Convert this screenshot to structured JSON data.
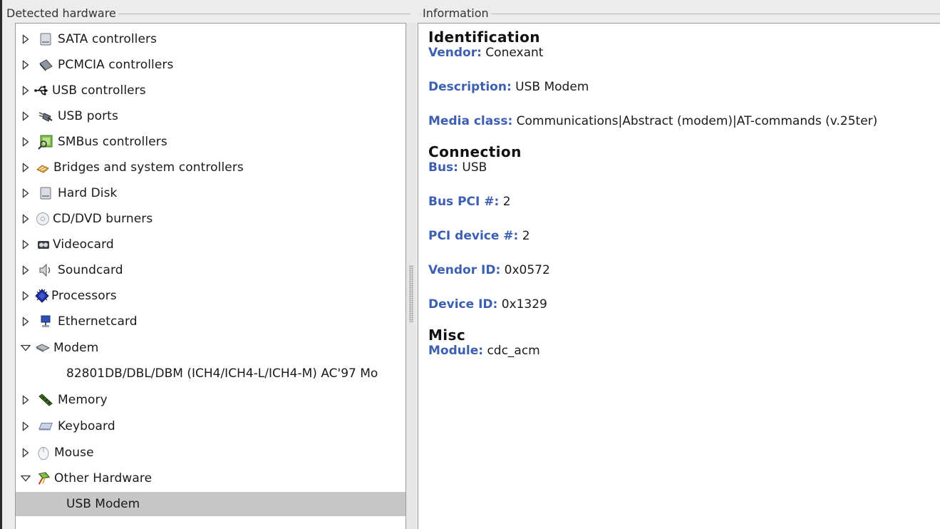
{
  "left_panel": {
    "title": "Detected hardware",
    "items": [
      {
        "label": "SATA controllers",
        "icon": "sata-controller-icon",
        "expanded": false
      },
      {
        "label": "PCMCIA controllers",
        "icon": "pcmcia-card-icon",
        "expanded": false
      },
      {
        "label": "USB controllers",
        "icon": "usb-symbol-icon",
        "expanded": false
      },
      {
        "label": "USB ports",
        "icon": "usb-plug-icon",
        "expanded": false
      },
      {
        "label": "SMBus controllers",
        "icon": "smbus-icon",
        "expanded": false
      },
      {
        "label": "Bridges and system controllers",
        "icon": "bridge-icon",
        "expanded": false
      },
      {
        "label": "Hard Disk",
        "icon": "hard-disk-icon",
        "expanded": false
      },
      {
        "label": "CD/DVD burners",
        "icon": "cd-dvd-icon",
        "expanded": false
      },
      {
        "label": "Videocard",
        "icon": "videocard-icon",
        "expanded": false
      },
      {
        "label": "Soundcard",
        "icon": "speaker-icon",
        "expanded": false
      },
      {
        "label": "Processors",
        "icon": "processor-icon",
        "expanded": false
      },
      {
        "label": "Ethernetcard",
        "icon": "ethernet-icon",
        "expanded": false
      },
      {
        "label": "Modem",
        "icon": "modem-icon",
        "expanded": true
      },
      {
        "label": "82801DB/DBL/DBM (ICH4/ICH4-L/ICH4-M) AC'97 Mo",
        "child": true
      },
      {
        "label": "Memory",
        "icon": "memory-icon",
        "expanded": false
      },
      {
        "label": "Keyboard",
        "icon": "keyboard-icon",
        "expanded": false
      },
      {
        "label": "Mouse",
        "icon": "mouse-icon",
        "expanded": false
      },
      {
        "label": "Other Hardware",
        "icon": "other-hardware-icon",
        "expanded": true
      },
      {
        "label": "USB Modem",
        "child": true,
        "selected": true
      }
    ]
  },
  "right_panel": {
    "title": "Information",
    "identification": {
      "heading": "Identification",
      "vendor_key": "Vendor:",
      "vendor_val": "Conexant",
      "description_key": "Description:",
      "description_val": "USB Modem",
      "media_class_key": "Media class:",
      "media_class_val": "Communications|Abstract (modem)|AT-commands (v.25ter)"
    },
    "connection": {
      "heading": "Connection",
      "bus_key": "Bus:",
      "bus_val": "USB",
      "bus_pci_key": "Bus PCI #:",
      "bus_pci_val": "2",
      "pci_device_key": "PCI device #:",
      "pci_device_val": "2",
      "vendor_id_key": "Vendor ID:",
      "vendor_id_val": "0x0572",
      "device_id_key": "Device ID:",
      "device_id_val": "0x1329"
    },
    "misc": {
      "heading": "Misc",
      "module_key": "Module:",
      "module_val": "cdc_acm"
    }
  },
  "colors": {
    "key_blue": "#3d5fb0",
    "selection_gray": "#c6c6c6"
  }
}
